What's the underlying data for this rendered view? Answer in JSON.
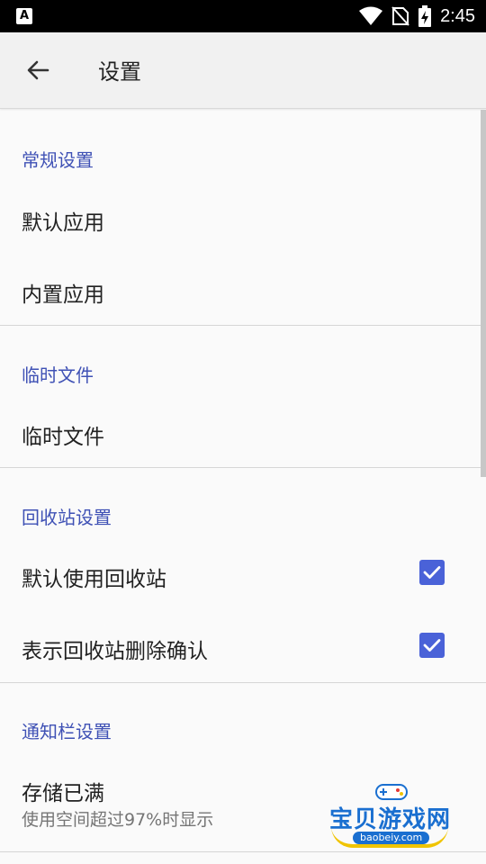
{
  "status_bar": {
    "notification_badge": "A",
    "time": "2:45",
    "icons": [
      "wifi-icon",
      "no-sim-icon",
      "battery-charging-icon"
    ]
  },
  "app_bar": {
    "title": "设置",
    "back_icon": "arrow-left-icon"
  },
  "sections": [
    {
      "header": "常规设置",
      "items": [
        {
          "label": "默认应用"
        },
        {
          "label": "内置应用"
        }
      ]
    },
    {
      "header": "临时文件",
      "items": [
        {
          "label": "临时文件"
        }
      ]
    },
    {
      "header": "回收站设置",
      "items": [
        {
          "label": "默认使用回收站",
          "checked": true
        },
        {
          "label": "表示回收站删除确认",
          "checked": true
        }
      ]
    },
    {
      "header": "通知栏设置",
      "items": [
        {
          "label": "存储已满",
          "summary": "使用空间超过97%时显示"
        }
      ]
    }
  ],
  "watermark": {
    "text": "宝贝游戏网",
    "url": "baobeiy.com"
  },
  "colors": {
    "accent": "#3f51b5",
    "checkbox": "#4a62d8",
    "app_bar": "#f1f1f1",
    "background": "#fafafa"
  }
}
